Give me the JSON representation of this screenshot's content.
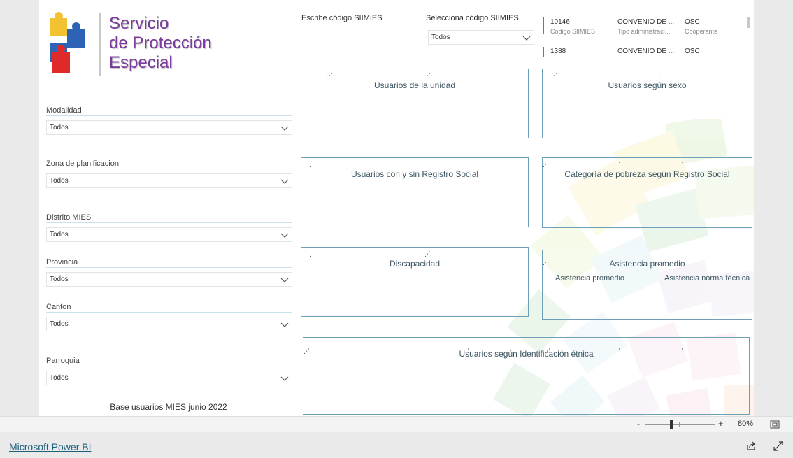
{
  "logo": {
    "line1": "Servicio",
    "line2": "de Protección",
    "line3": "Especial"
  },
  "slicers": [
    {
      "label": "Modalidad",
      "value": "Todos"
    },
    {
      "label": "Zona de planificacion",
      "value": "Todos"
    },
    {
      "label": "Distrito MIES",
      "value": "Todos"
    },
    {
      "label": "Provincia",
      "value": "Todos"
    },
    {
      "label": "Canton",
      "value": "Todos"
    },
    {
      "label": "Parroquia",
      "value": "Todos"
    }
  ],
  "footnote": "Base usuarios MIES junio 2022",
  "siimies": {
    "write_label": "Escribe código SIIMIES",
    "select_label": "Selecciona código SIIMIES",
    "select_value": "Todos"
  },
  "table": {
    "rows": [
      {
        "code": "10146",
        "code_sub": "Codigo SIIMIES",
        "type": "CONVENIO DE ...",
        "type_sub": "Tipo administraci...",
        "osc": "OSC",
        "osc_sub": "Cooperante"
      },
      {
        "code": "1388",
        "type": "CONVENIO DE ...",
        "osc": "OSC"
      }
    ]
  },
  "visuals": {
    "usuarios_unidad": "Usuarios de la unidad",
    "usuarios_sexo": "Usuarios según sexo",
    "registro_social": "Usuarios con y sin Registro Social",
    "pobreza": "Categoría de pobreza según Registro Social",
    "discapacidad": "Discapacidad",
    "asistencia": "Asistencia promedio",
    "asistencia_sub1": "Asistencia promedio",
    "asistencia_sub2": "Asistencia norma técnica",
    "etnica": "Usuarios según Identificación étnica"
  },
  "zoom": {
    "minus": "-",
    "plus": "+",
    "value": "80%"
  },
  "footer": {
    "link": "Microsoft Power BI"
  },
  "colors": {
    "accent": "#7b3a9c",
    "box_border": "#6e9fb8",
    "link": "#1e5e7a"
  }
}
